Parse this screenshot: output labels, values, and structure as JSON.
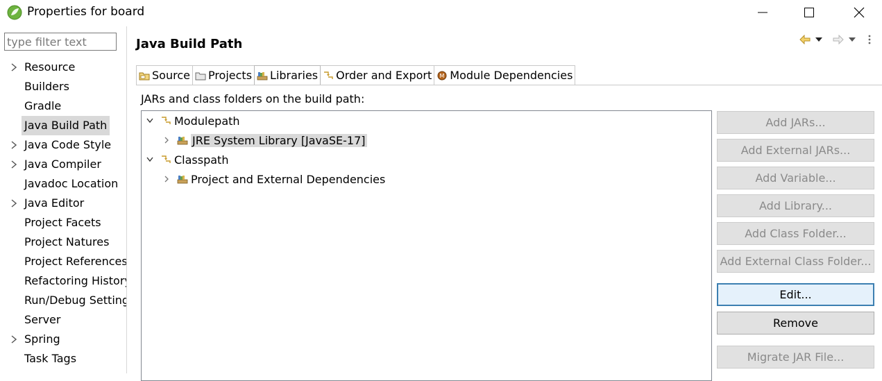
{
  "window": {
    "title": "Properties for board",
    "icons": {
      "app": "spring-leaf-icon",
      "minimize": "minimize-icon",
      "maximize": "maximize-icon",
      "close": "close-icon"
    }
  },
  "filter": {
    "placeholder": "type filter text",
    "value": ""
  },
  "nav": {
    "items": [
      {
        "label": "Resource",
        "expandable": true
      },
      {
        "label": "Builders",
        "expandable": false
      },
      {
        "label": "Gradle",
        "expandable": false
      },
      {
        "label": "Java Build Path",
        "expandable": false,
        "selected": true
      },
      {
        "label": "Java Code Style",
        "expandable": true
      },
      {
        "label": "Java Compiler",
        "expandable": true
      },
      {
        "label": "Javadoc Location",
        "expandable": false
      },
      {
        "label": "Java Editor",
        "expandable": true
      },
      {
        "label": "Project Facets",
        "expandable": false
      },
      {
        "label": "Project Natures",
        "expandable": false
      },
      {
        "label": "Project References",
        "expandable": false
      },
      {
        "label": "Refactoring History",
        "expandable": false
      },
      {
        "label": "Run/Debug Settings",
        "expandable": false
      },
      {
        "label": "Server",
        "expandable": false
      },
      {
        "label": "Spring",
        "expandable": true
      },
      {
        "label": "Task Tags",
        "expandable": false
      }
    ]
  },
  "page": {
    "title": "Java Build Path",
    "tabs": [
      {
        "label": "Source",
        "icon": "source-folder-icon"
      },
      {
        "label": "Projects",
        "icon": "projects-icon"
      },
      {
        "label": "Libraries",
        "icon": "library-icon",
        "active": true
      },
      {
        "label": "Order and Export",
        "icon": "order-export-icon"
      },
      {
        "label": "Module Dependencies",
        "icon": "module-icon"
      }
    ],
    "section_label": "JARs and class folders on the build path:",
    "tree": {
      "modulepath": "Modulepath",
      "jre": "JRE System Library [JavaSE-17]",
      "classpath": "Classpath",
      "deps": "Project and External Dependencies"
    },
    "buttons": {
      "add_jars": "Add JARs...",
      "add_external_jars": "Add External JARs...",
      "add_variable": "Add Variable...",
      "add_library": "Add Library...",
      "add_class_folder": "Add Class Folder...",
      "add_external_class_folder": "Add External Class Folder...",
      "edit": "Edit...",
      "remove": "Remove",
      "migrate_jar": "Migrate JAR File..."
    }
  },
  "colors": {
    "selection": "#d9d9d9",
    "focus_border": "#3c7fb1",
    "disabled_text": "#8a8a8a"
  }
}
